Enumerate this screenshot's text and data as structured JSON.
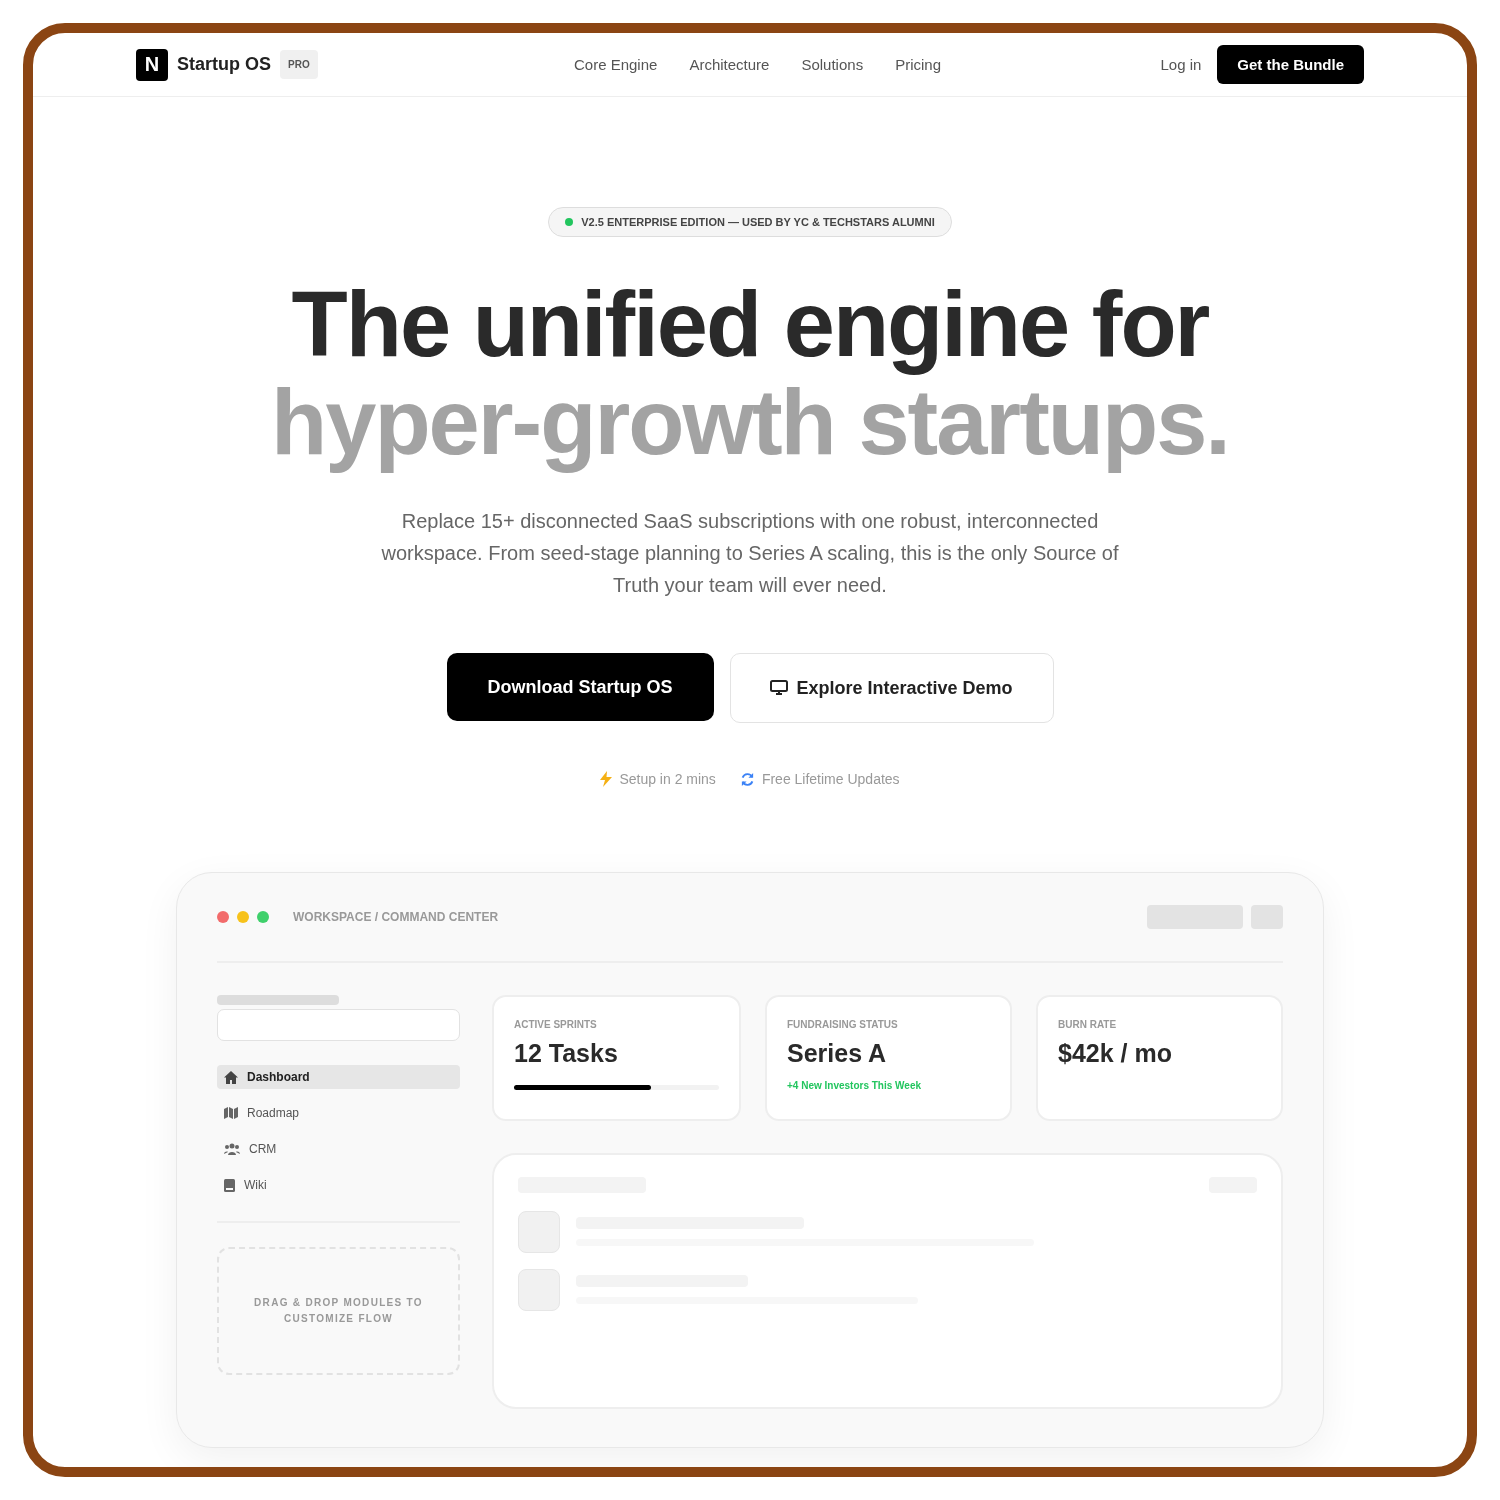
{
  "brand": {
    "logo": "N",
    "name": "Startup OS",
    "badge": "PRO"
  },
  "nav": {
    "links": [
      "Core Engine",
      "Architecture",
      "Solutions",
      "Pricing"
    ],
    "login": "Log in",
    "cta": "Get the Bundle"
  },
  "hero": {
    "pill": "V2.5 ENTERPRISE EDITION — USED BY YC & TECHSTARS ALUMNI",
    "title_line1": "The unified engine for",
    "title_line2": "hyper-growth startups.",
    "lede": "Replace 15+ disconnected SaaS subscriptions with one robust, interconnected workspace. From seed-stage planning to Series A scaling, this is the only Source of Truth your team will ever need.",
    "primary": "Download Startup OS",
    "secondary": "Explore Interactive Demo",
    "perks": [
      "Setup in 2 mins",
      "Free Lifetime Updates"
    ]
  },
  "app": {
    "path": "WORKSPACE / COMMAND CENTER",
    "sidebar": [
      {
        "label": "Dashboard",
        "selected": true
      },
      {
        "label": "Roadmap",
        "selected": false
      },
      {
        "label": "CRM",
        "selected": false
      },
      {
        "label": "Wiki",
        "selected": false
      }
    ],
    "dropzone": "DRAG & DROP MODULES TO CUSTOMIZE FLOW",
    "stats": [
      {
        "kind": "progress",
        "label": "ACTIVE SPRINTS",
        "value": "12 Tasks",
        "level": 0.67
      },
      {
        "kind": "note",
        "label": "FUNDRAISING STATUS",
        "value": "Series A",
        "note": "+4 New Investors This Week"
      },
      {
        "kind": "plain",
        "label": "BURN RATE",
        "value": "$42k / mo"
      }
    ]
  }
}
